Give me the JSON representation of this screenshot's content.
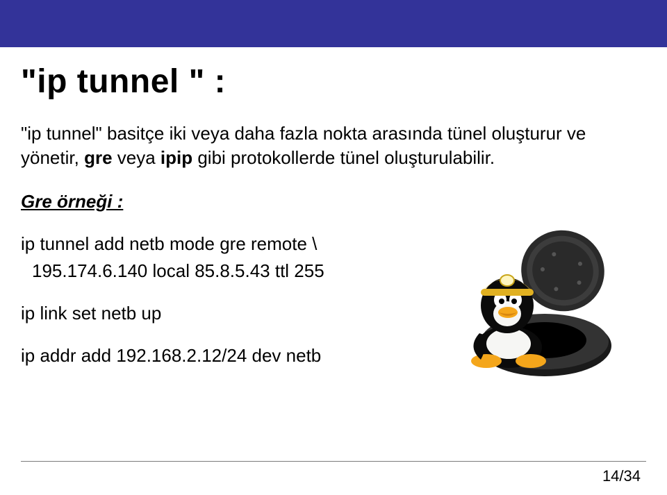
{
  "header": {
    "title": "\"ip tunnel \" :"
  },
  "body": {
    "para_open_quote": "\"",
    "para_text1": "ip tunnel\" basitçe iki veya daha fazla nokta arasında tünel oluşturur ve yönetir, ",
    "para_bold1": "gre",
    "para_text2": " veya ",
    "para_bold2": "ipip",
    "para_text3": " gibi protokollerde tünel oluşturulabilir.",
    "example_label": "Gre örneği :",
    "cmd1_line1": "ip tunnel add netb mode gre remote \\",
    "cmd1_line2": "195.174.6.140 local 85.8.5.43 ttl 255",
    "cmd2": "ip link set netb up",
    "cmd3": "ip addr add 192.168.2.12/24 dev netb"
  },
  "footer": {
    "page_number": "14/34"
  },
  "mascot": {
    "name": "tux-manhole-icon"
  }
}
